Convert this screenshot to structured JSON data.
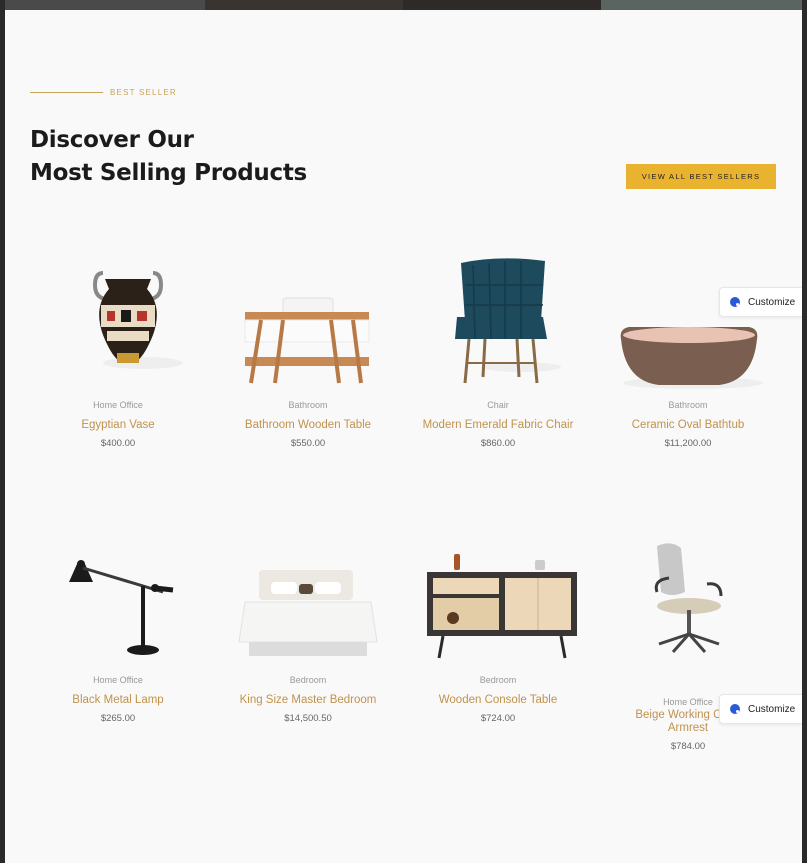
{
  "section": {
    "eyebrow": "BEST SELLER",
    "title_line1": "Discover Our",
    "title_line2": "Most Selling Products",
    "cta": "VIEW ALL BEST SELLERS"
  },
  "products": [
    {
      "category": "Home Office",
      "name": "Egyptian Vase",
      "price": "$400.00",
      "icon": "vase"
    },
    {
      "category": "Bathroom",
      "name": "Bathroom Wooden Table",
      "price": "$550.00",
      "icon": "table"
    },
    {
      "category": "Chair",
      "name": "Modern Emerald Fabric Chair",
      "price": "$860.00",
      "icon": "chair"
    },
    {
      "category": "Bathroom",
      "name": "Ceramic Oval Bathtub",
      "price": "$11,200.00",
      "icon": "bathtub"
    },
    {
      "category": "Home Office",
      "name": "Black Metal Lamp",
      "price": "$265.00",
      "icon": "lamp"
    },
    {
      "category": "Bedroom",
      "name": "King Size Master Bedroom",
      "price": "$14,500.50",
      "icon": "bed"
    },
    {
      "category": "Bedroom",
      "name": "Wooden Console Table",
      "price": "$724.00",
      "icon": "console"
    },
    {
      "category": "Home Office",
      "name": "Beige Working Chair Armrest",
      "price": "$784.00",
      "icon": "office-chair"
    }
  ],
  "customize": {
    "label": "Customize"
  },
  "colors": {
    "accent": "#c0924d",
    "button": "#e9b32f",
    "background": "#f9f9f9"
  }
}
